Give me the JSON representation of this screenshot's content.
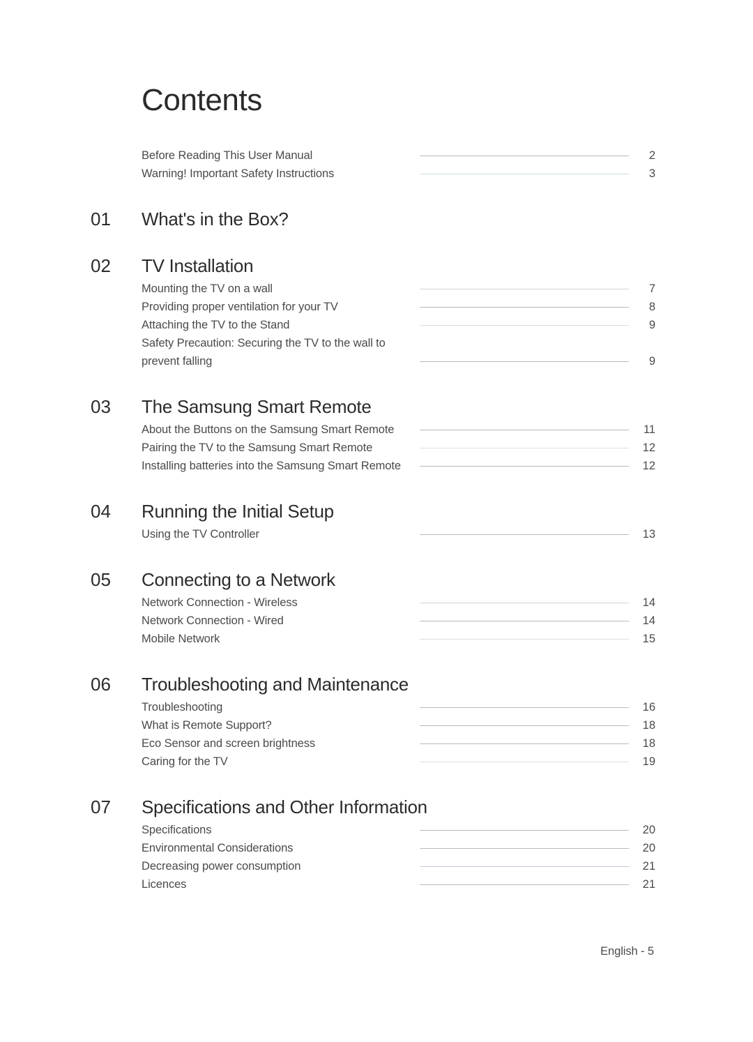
{
  "document": {
    "title": "Contents",
    "footer": "English - 5"
  },
  "intro_entries": [
    {
      "label": "Before Reading This User Manual",
      "page": "2",
      "leader": "normal"
    },
    {
      "label": "Warning! Important Safety Instructions",
      "page": "3",
      "leader": "teal"
    }
  ],
  "chapters": [
    {
      "number": "01",
      "title": "What's in the Box?",
      "entries": []
    },
    {
      "number": "02",
      "title": "TV Installation",
      "entries": [
        {
          "label": "Mounting the TV on a wall",
          "page": "7",
          "leader": "light"
        },
        {
          "label": "Providing proper ventilation for your TV",
          "page": "8",
          "leader": "normal"
        },
        {
          "label": "Attaching the TV to the Stand",
          "page": "9",
          "leader": "lighter"
        },
        {
          "label": "Safety Precaution: Securing the TV to the wall to prevent falling",
          "page": "9",
          "leader": "normal",
          "wrap": true
        }
      ]
    },
    {
      "number": "03",
      "title": "The Samsung Smart Remote",
      "entries": [
        {
          "label": "About the Buttons on the Samsung Smart Remote",
          "page": "11",
          "leader": "normal"
        },
        {
          "label": "Pairing the TV to the Samsung Smart Remote",
          "page": "12",
          "leader": "lighter"
        },
        {
          "label": "Installing batteries into the Samsung Smart Remote",
          "page": "12",
          "leader": "normal"
        }
      ]
    },
    {
      "number": "04",
      "title": "Running the Initial Setup",
      "entries": [
        {
          "label": "Using the TV Controller",
          "page": "13",
          "leader": "normal"
        }
      ]
    },
    {
      "number": "05",
      "title": "Connecting to a Network",
      "entries": [
        {
          "label": "Network Connection - Wireless",
          "page": "14",
          "leader": "light"
        },
        {
          "label": "Network Connection - Wired",
          "page": "14",
          "leader": "normal"
        },
        {
          "label": "Mobile Network",
          "page": "15",
          "leader": "lighter"
        }
      ]
    },
    {
      "number": "06",
      "title": "Troubleshooting and Maintenance",
      "entries": [
        {
          "label": "Troubleshooting",
          "page": "16",
          "leader": "normal"
        },
        {
          "label": "What is Remote Support?",
          "page": "18",
          "leader": "normal"
        },
        {
          "label": "Eco Sensor and screen brightness",
          "page": "18",
          "leader": "normal"
        },
        {
          "label": "Caring for the TV",
          "page": "19",
          "leader": "lighter"
        }
      ]
    },
    {
      "number": "07",
      "title": "Specifications and Other Information",
      "entries": [
        {
          "label": "Specifications",
          "page": "20",
          "leader": "normal"
        },
        {
          "label": "Environmental Considerations",
          "page": "20",
          "leader": "normal"
        },
        {
          "label": "Decreasing power consumption",
          "page": "21",
          "leader": "blue"
        },
        {
          "label": "Licences",
          "page": "21",
          "leader": "normal"
        }
      ]
    }
  ]
}
